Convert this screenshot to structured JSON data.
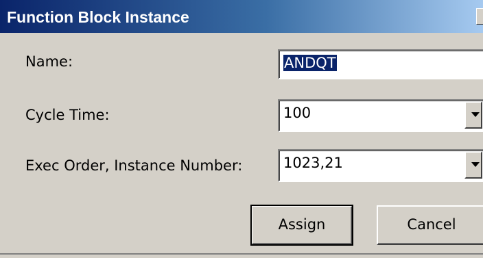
{
  "window": {
    "title": "Function Block Instance"
  },
  "form": {
    "name_label": "Name:",
    "name_value": "ANDQT",
    "cycle_time_label": "Cycle Time:",
    "cycle_time_value": "100",
    "exec_order_label": "Exec Order, Instance Number:",
    "exec_order_value": "1023,21"
  },
  "buttons": {
    "assign_label": "Assign",
    "cancel_label": "Cancel"
  },
  "icons": {
    "dropdown": "chevron-down-icon"
  },
  "colors": {
    "title_bar_start": "#0a246a",
    "title_bar_end": "#a6caf0",
    "dialog_face": "#d4d0c8",
    "selection": "#0a246a"
  }
}
